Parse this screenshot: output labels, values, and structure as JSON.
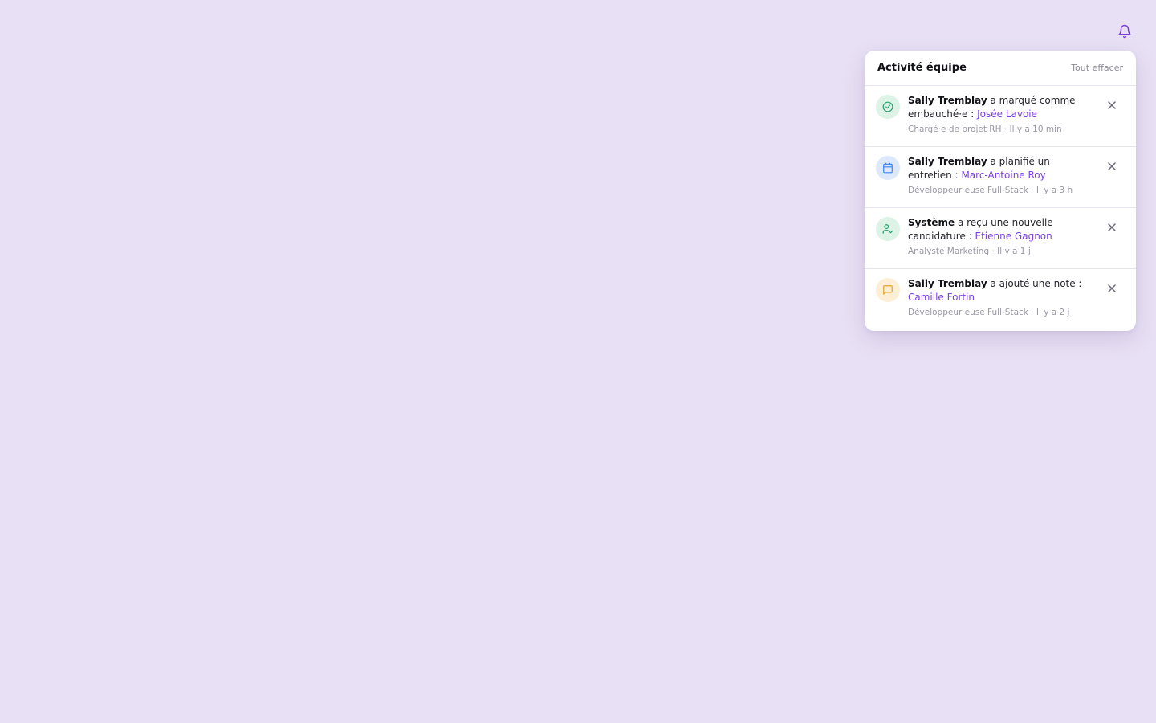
{
  "header": {
    "bell_icon": "bell-icon",
    "accent": "#7b3fe0"
  },
  "panel": {
    "title": "Activité équipe",
    "clear_all": "Tout effacer",
    "items": [
      {
        "icon": "check-circle-icon",
        "icon_color": "#22a06b",
        "icon_bg": "#dcf3e6",
        "actor": "Sally Tremblay",
        "action": " a marqué comme embauché·e : ",
        "candidate": "Josée Lavoie",
        "meta": "Chargé·e de projet RH · Il y a 10 min"
      },
      {
        "icon": "calendar-icon",
        "icon_color": "#3b82f6",
        "icon_bg": "#dde9fb",
        "actor": "Sally Tremblay",
        "action": " a planifié un entretien : ",
        "candidate": "Marc-Antoine Roy",
        "meta": "Développeur·euse Full-Stack · Il y a 3 h"
      },
      {
        "icon": "user-check-icon",
        "icon_color": "#22a06b",
        "icon_bg": "#dcf3e6",
        "actor": "Système",
        "action": " a reçu une nouvelle candidature : ",
        "candidate": "Étienne Gagnon",
        "meta": "Analyste Marketing · Il y a 1 j"
      },
      {
        "icon": "message-square-icon",
        "icon_color": "#e0a526",
        "icon_bg": "#fcefd6",
        "actor": "Sally Tremblay",
        "action": " a ajouté une note : ",
        "candidate": "Camille Fortin",
        "meta": "Développeur·euse Full-Stack · Il y a 2 j"
      }
    ]
  }
}
